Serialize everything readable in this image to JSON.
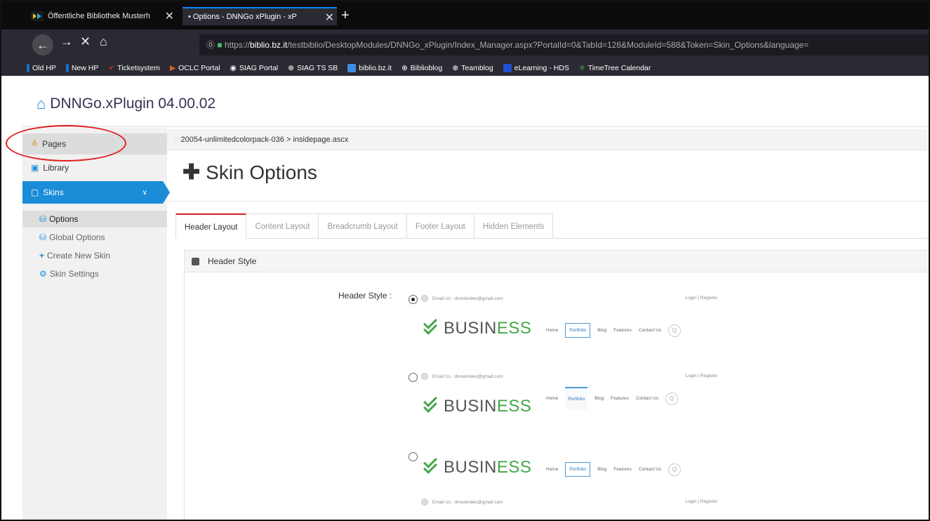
{
  "browser": {
    "tabs": [
      {
        "label": "Öffentliche Bibliothek Musterh",
        "active": false
      },
      {
        "label": "• Options - DNNGo xPlugin - xP",
        "active": true
      }
    ],
    "url_prefix": "https://",
    "url_domain": "biblio.bz.it",
    "url_path": "/testbiblio/DesktopModules/DNNGo_xPlugin/Index_Manager.aspx?PortalId=0&TabId=128&ModuleId=588&Token=Skin_Options&language=",
    "bookmarks": [
      {
        "label": "Old HP",
        "color": "#1a6fd0"
      },
      {
        "label": "New HP",
        "color": "#1a6fd0"
      },
      {
        "label": "Ticketsystem",
        "color": "#d03030"
      },
      {
        "label": "OCLC Portal",
        "color": "#e06020"
      },
      {
        "label": "SIAG Portal",
        "color": "#ffffff"
      },
      {
        "label": "SIAG TS SB",
        "color": "#cccccc"
      },
      {
        "label": "biblio.bz.it",
        "color": "#3a8fe0"
      },
      {
        "label": "Biblioblog",
        "color": "#cccccc"
      },
      {
        "label": "Teamblog",
        "color": "#cccccc"
      },
      {
        "label": "eLearning - HDS",
        "color": "#2050d0"
      },
      {
        "label": "TimeTree Calendar",
        "color": "#40b040"
      }
    ]
  },
  "app": {
    "title": "DNNGo.xPlugin 04.00.02"
  },
  "sidebar": {
    "items": [
      {
        "label": "Pages"
      },
      {
        "label": "Library"
      },
      {
        "label": "Skins"
      }
    ],
    "sub_items": [
      {
        "label": "Options"
      },
      {
        "label": "Global Options"
      },
      {
        "label": "Create New Skin"
      },
      {
        "label": "Skin Settings"
      }
    ]
  },
  "breadcrumb": "20054-unlimitedcolorpack-036 > insidepage.ascx",
  "main": {
    "title": "Skin Options",
    "tabs": [
      "Header Layout",
      "Content Layout",
      "Breadcrumb Layout",
      "Footer Layout",
      "Hidden Elements"
    ],
    "panel_title": "Header Style",
    "field_label": "Header Style :"
  },
  "preview": {
    "email": "Email Us : dnnskindev@gmail.com",
    "login": "Login | Register",
    "logo_a": "BUSIN",
    "logo_b": "ESS",
    "menu": [
      "Home",
      "Portfolio",
      "Blog",
      "Features",
      "Contact Us"
    ],
    "search": "Q"
  },
  "colors": {
    "accent": "#1a8cd8",
    "highlight_circle": "#e02020",
    "logo_green": "#44a649"
  }
}
